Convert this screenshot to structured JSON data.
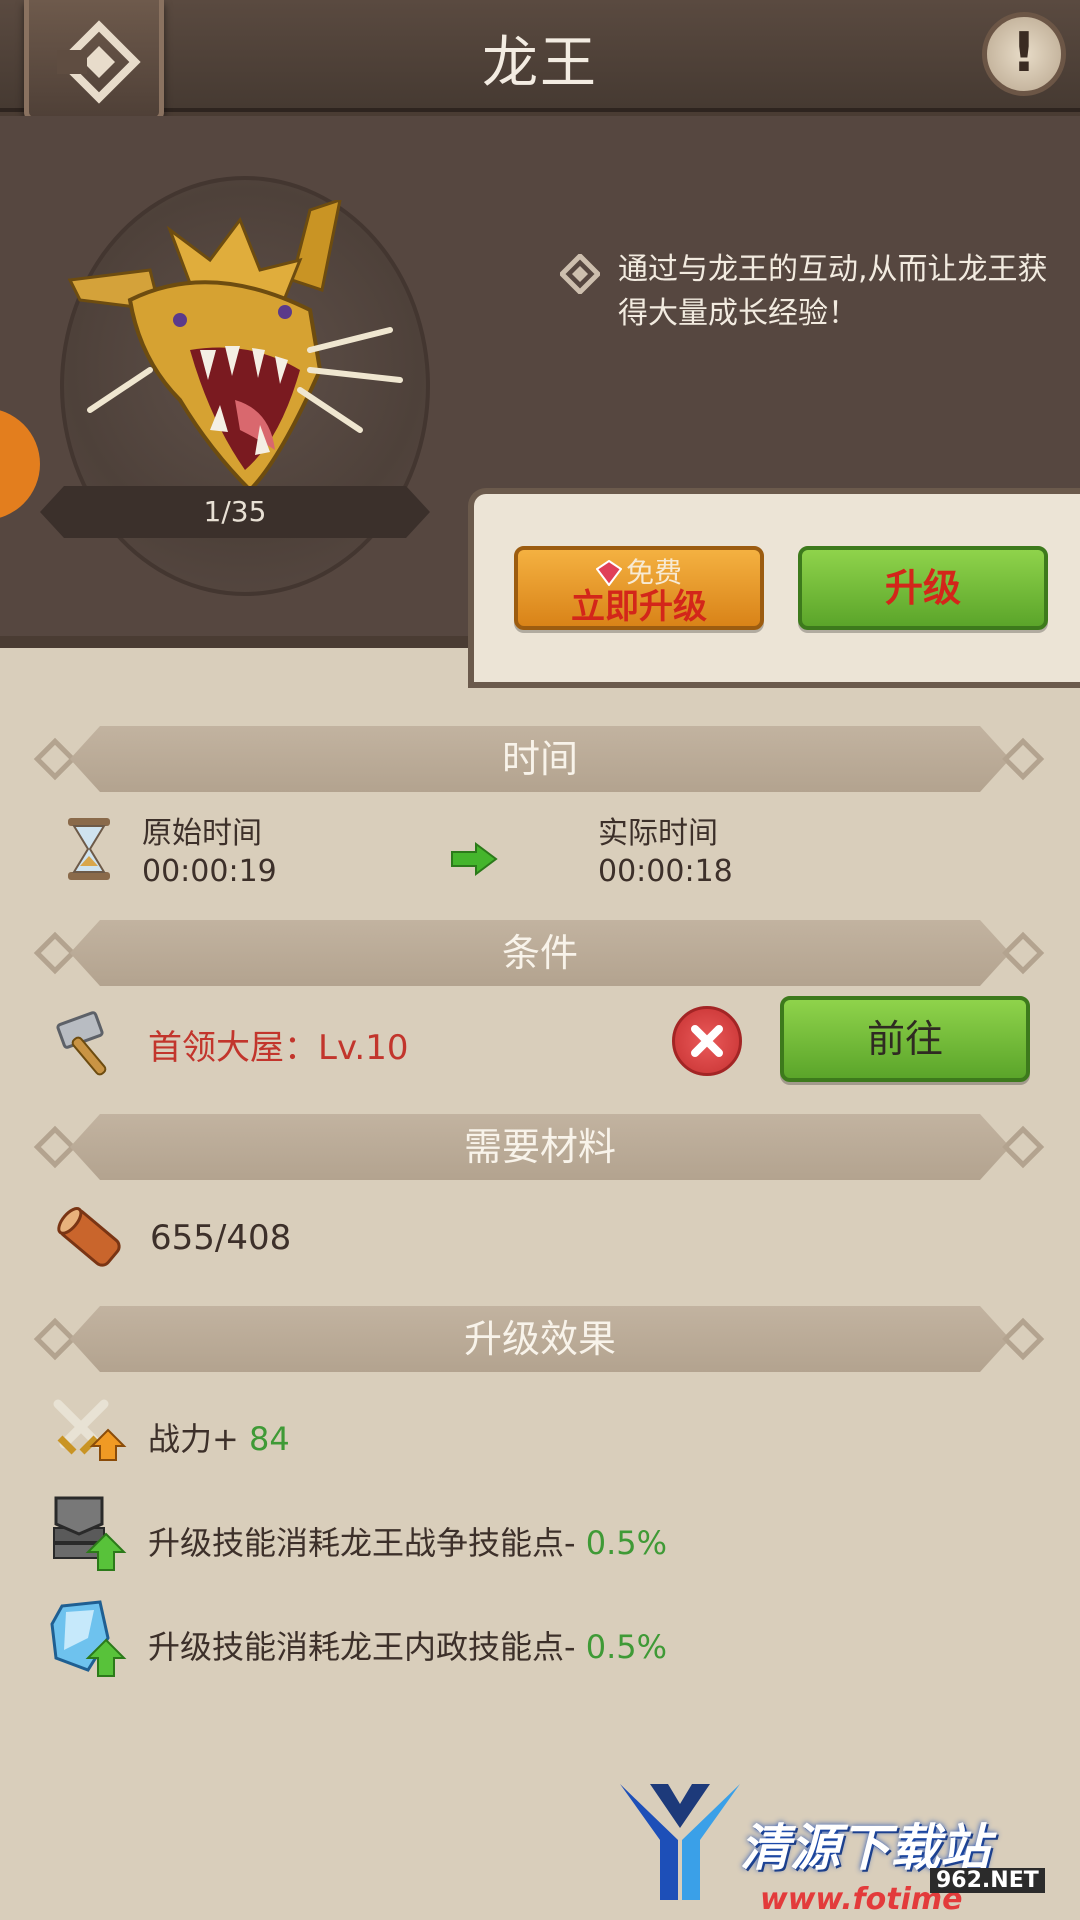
{
  "header": {
    "title": "龙王",
    "back_icon": "back-diamond-icon",
    "info_label": "!"
  },
  "hero": {
    "counter": "1/35",
    "description": "通过与龙王的互动,从而让龙王获得大量成长经验！"
  },
  "actions": {
    "free_label": "免费",
    "instant_upgrade_label": "立即升级",
    "upgrade_label": "升级"
  },
  "time_section": {
    "title": "时间",
    "original_label": "原始时间",
    "original_value": "00:00:19",
    "actual_label": "实际时间",
    "actual_value": "00:00:18"
  },
  "condition_section": {
    "title": "条件",
    "requirement": "首领大屋：Lv.10",
    "go_label": "前往"
  },
  "materials_section": {
    "title": "需要材料",
    "wood_amount": "655/408"
  },
  "effects_section": {
    "title": "升级效果",
    "items": [
      {
        "label": "战力+ ",
        "value": "84"
      },
      {
        "label": "升级技能消耗龙王战争技能点- ",
        "value": "0.5%"
      },
      {
        "label": "升级技能消耗龙王内政技能点- ",
        "value": "0.5%"
      }
    ]
  },
  "watermark": {
    "brand": "清源下载站",
    "url": "www.fotime",
    "net": "962.NET"
  },
  "colors": {
    "header_bg": "#4f4037",
    "panel_bg": "#d9cebb",
    "red_text": "#c2352c",
    "green_text": "#3f9a36",
    "green_button": "#6cb832",
    "orange_button": "#e69a2a"
  }
}
